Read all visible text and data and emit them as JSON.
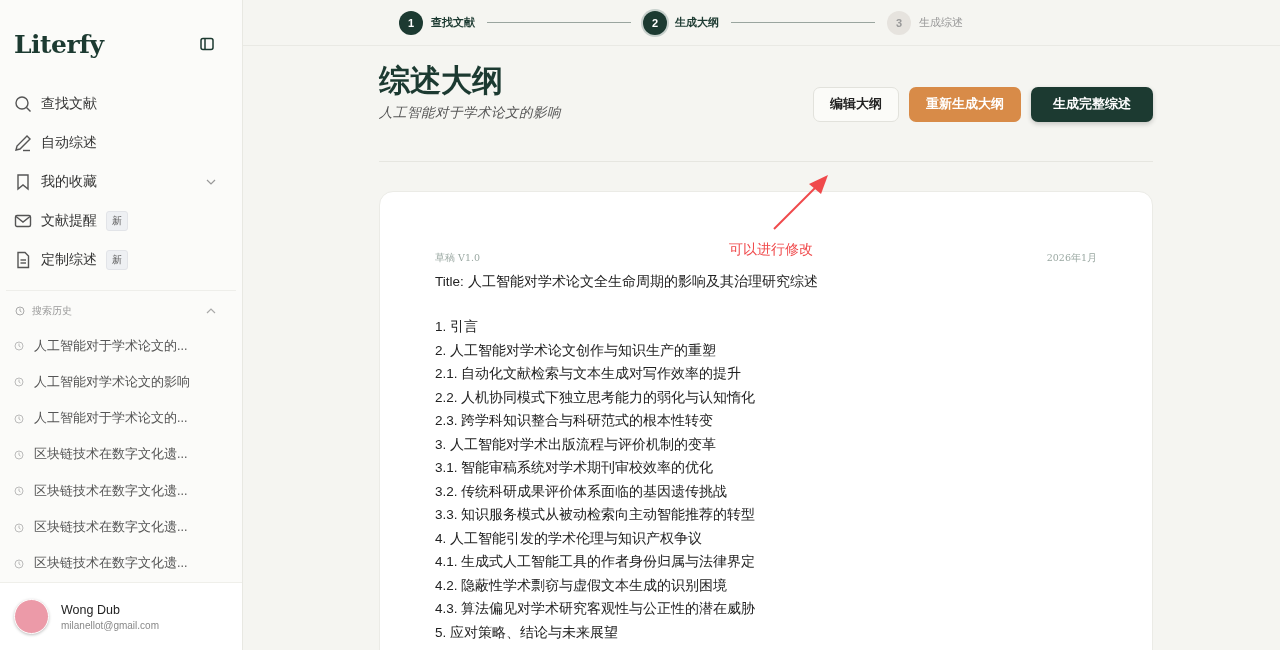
{
  "sidebar": {
    "logo": "Literfy",
    "nav": [
      {
        "kind": "search",
        "label": "查找文献"
      },
      {
        "kind": "pen",
        "label": "自动综述"
      },
      {
        "kind": "bookmark",
        "label": "我的收藏",
        "expanded": false
      },
      {
        "kind": "mail",
        "label": "文献提醒",
        "badge": "新"
      },
      {
        "kind": "doc",
        "label": "定制综述",
        "badge": "新"
      }
    ],
    "history": {
      "title": "搜索历史",
      "expanded": true,
      "items": [
        "人工智能对于学术论文的...",
        "人工智能对学术论文的影响",
        "人工智能对于学术论文的...",
        "区块链技术在数字文化遗...",
        "区块链技术在数字文化遗...",
        "区块链技术在数字文化遗...",
        "区块链技术在数字文化遗..."
      ]
    },
    "user": {
      "name": "Wong Dub",
      "email": "milanellot@gmail.com"
    }
  },
  "steps": [
    {
      "number": "1",
      "label": "查找文献",
      "completed": true,
      "selected": false
    },
    {
      "number": "2",
      "label": "生成大纲",
      "completed": false,
      "selected": true
    },
    {
      "number": "3",
      "label": "生成综述",
      "completed": false,
      "selected": false
    }
  ],
  "header": {
    "title": "综述大纲",
    "subtitle": "人工智能对于学术论文的影响",
    "buttons": [
      {
        "kind": "outline",
        "label": "编辑大纲"
      },
      {
        "kind": "accent",
        "label": "重新生成大纲"
      },
      {
        "kind": "primary",
        "label": "生成完整综述"
      }
    ]
  },
  "annotation": {
    "text": "可以进行修改"
  },
  "outline": {
    "draft": "草稿 V1.0",
    "date": "2026年1月",
    "title": "Title: 人工智能对学术论文全生命周期的影响及其治理研究综述",
    "lines": [
      "1. 引言",
      "2. 人工智能对学术论文创作与知识生产的重塑",
      "2.1. 自动化文献检索与文本生成对写作效率的提升",
      "2.2. 人机协同模式下独立思考能力的弱化与认知惰化",
      "2.3. 跨学科知识整合与科研范式的根本性转变",
      "3. 人工智能对学术出版流程与评价机制的变革",
      "3.1. 智能审稿系统对学术期刊审校效率的优化",
      "3.2. 传统科研成果评价体系面临的基因遗传挑战",
      "3.3. 知识服务模式从被动检索向主动智能推荐的转型",
      "4. 人工智能引发的学术伦理与知识产权争议",
      "4.1. 生成式人工智能工具的作者身份归属与法律界定",
      "4.2. 隐蔽性学术剽窃与虚假文本生成的识别困境",
      "4.3. 算法偏见对学术研究客观性与公正性的潜在威胁",
      "5. 应对策略、结论与未来展望"
    ]
  }
}
